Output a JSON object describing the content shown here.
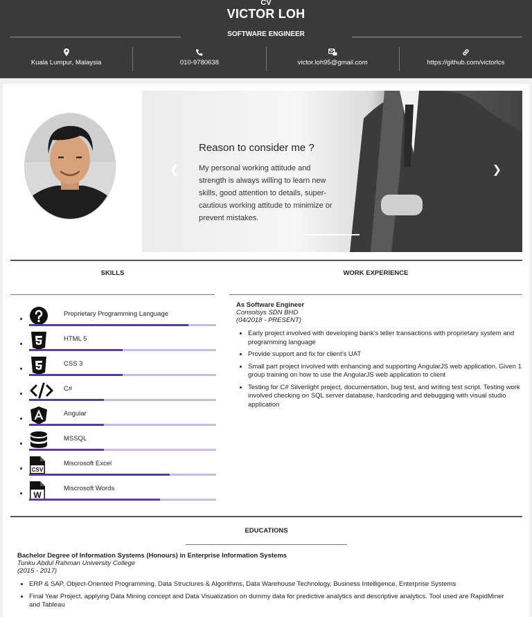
{
  "header": {
    "cv_label": "CV",
    "name": "VICTOR LOH",
    "title": "SOFTWARE ENGINEER",
    "contacts": [
      {
        "icon": "location-pin-icon",
        "text": "Kuala Lumpur, Malaysia"
      },
      {
        "icon": "phone-icon",
        "text": "010-9780638"
      },
      {
        "icon": "mail-icon",
        "text": "victor.loh95@gmail.com"
      },
      {
        "icon": "link-icon",
        "text": "https://github.com/victorlcs"
      }
    ]
  },
  "hero": {
    "heading": "Reason to consider me ?",
    "text": "My personal working attitude and strength is always willing to learn new skills, good attention to details, super-cautious working attitude to minimize or prevent mistakes."
  },
  "sections": {
    "skills": "SKILLS",
    "experience": "WORK EXPERIENCE",
    "educations": "EDUCATIONS"
  },
  "skills": [
    {
      "name": "Proprietary Programming Language",
      "icon": "question-circle-icon",
      "level": 0.85
    },
    {
      "name": "HTML 5",
      "icon": "html5-icon",
      "level": 0.5
    },
    {
      "name": "CSS 3",
      "icon": "css3-icon",
      "level": 0.5
    },
    {
      "name": "C#",
      "icon": "code-icon",
      "level": 0.4
    },
    {
      "name": "Angular",
      "icon": "angular-icon",
      "level": 0.4
    },
    {
      "name": "MSSQL",
      "icon": "database-icon",
      "level": 0.4
    },
    {
      "name": "Miscrosoft Excel",
      "icon": "csv-file-icon",
      "level": 0.75
    },
    {
      "name": "Miscrosoft Words",
      "icon": "word-file-icon",
      "level": 0.7
    }
  ],
  "experience": {
    "role": "As Software Engineer",
    "company": "Consolsys SDN BHD",
    "dates": "(04/2018 - PRESENT)",
    "bullets": [
      "Early project involved with developing bank's teller transactions with proprietary system and programming language",
      "Provide support and fix for client's UAT",
      "Small part project involved with enhancing and supporting AngularJS web application. Given 1 group training on how to use the AngularJS web application to client",
      "Testing for C# Silverlight project, documentation, bug test, and writing test script. Testing work involved checking on SQL server database, hardcoding and debugging with visual studio application"
    ]
  },
  "education": {
    "degree": "Bachelor Degree of Information Systems (Honours) in Enterprise Information Systems",
    "university": "Tunku Abdul Rahman University College",
    "years": "(2015 - 2017)",
    "bullets": [
      "ERP & SAP, Object-Oriented Programming, Data Structures & Algorithms, Data Warehouse Technology, Business Intelligence, Enterprise Systems",
      "Final Year Project, applying Data Mining concept and Data Visualization on dummy data for predictive analytics and descriptive analytics. Tool used are RapidMiner and Tableau"
    ]
  }
}
